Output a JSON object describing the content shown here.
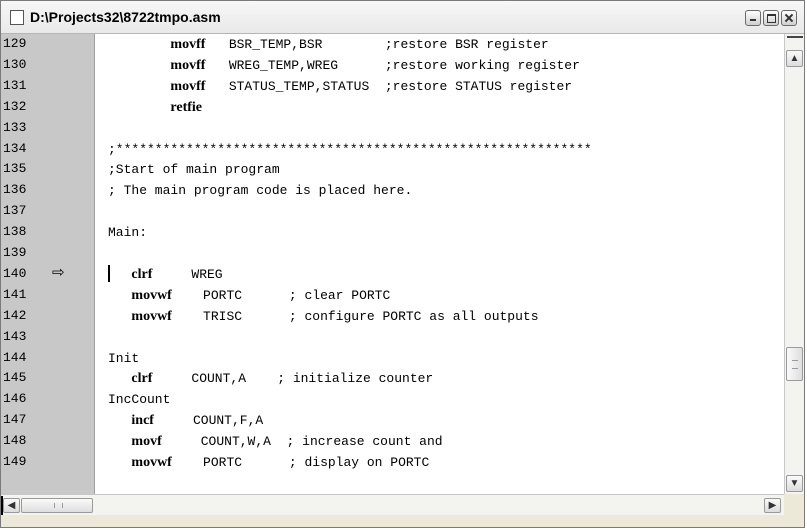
{
  "window": {
    "title": "D:\\Projects32\\8722tmpo.asm"
  },
  "titlebar_buttons": {
    "minimize": "minimize",
    "maximize": "maximize",
    "close": "close"
  },
  "icons": {
    "document": "document-icon",
    "arrow": "current-line-arrow-icon"
  },
  "lines": [
    {
      "num": "129",
      "mnemonic": "movff",
      "rest": "   BSR_TEMP,BSR        ;restore BSR register",
      "indent": "        "
    },
    {
      "num": "130",
      "mnemonic": "movff",
      "rest": "   WREG_TEMP,WREG      ;restore working register",
      "indent": "        "
    },
    {
      "num": "131",
      "mnemonic": "movff",
      "rest": "   STATUS_TEMP,STATUS  ;restore STATUS register",
      "indent": "        "
    },
    {
      "num": "132",
      "mnemonic": "retfie",
      "rest": "",
      "indent": "        "
    },
    {
      "num": "133",
      "mnemonic": "",
      "rest": "",
      "indent": ""
    },
    {
      "num": "134",
      "mnemonic": "",
      "rest": ";*************************************************************",
      "indent": ""
    },
    {
      "num": "135",
      "mnemonic": "",
      "rest": ";Start of main program",
      "indent": ""
    },
    {
      "num": "136",
      "mnemonic": "",
      "rest": "; The main program code is placed here.",
      "indent": ""
    },
    {
      "num": "137",
      "mnemonic": "",
      "rest": "",
      "indent": ""
    },
    {
      "num": "138",
      "mnemonic": "",
      "rest": "Main:",
      "indent": ""
    },
    {
      "num": "139",
      "mnemonic": "",
      "rest": "",
      "indent": ""
    },
    {
      "num": "140",
      "mnemonic": "clrf",
      "rest": "     WREG",
      "indent": "   "
    },
    {
      "num": "141",
      "mnemonic": "movwf",
      "rest": "    PORTC      ; clear PORTC",
      "indent": "   "
    },
    {
      "num": "142",
      "mnemonic": "movwf",
      "rest": "    TRISC      ; configure PORTC as all outputs",
      "indent": "   "
    },
    {
      "num": "143",
      "mnemonic": "",
      "rest": "",
      "indent": ""
    },
    {
      "num": "144",
      "mnemonic": "",
      "rest": "Init",
      "indent": ""
    },
    {
      "num": "145",
      "mnemonic": "clrf",
      "rest": "     COUNT,A    ; initialize counter",
      "indent": "   "
    },
    {
      "num": "146",
      "mnemonic": "",
      "rest": "IncCount",
      "indent": ""
    },
    {
      "num": "147",
      "mnemonic": "incf",
      "rest": "     COUNT,F,A",
      "indent": "   "
    },
    {
      "num": "148",
      "mnemonic": "movf",
      "rest": "     COUNT,W,A  ; increase count and",
      "indent": "   "
    },
    {
      "num": "149",
      "mnemonic": "movwf",
      "rest": "    PORTC      ; display on PORTC",
      "indent": "   "
    }
  ],
  "current_line": "140",
  "scrollbars": {
    "up": "scroll-up",
    "down": "scroll-down",
    "left": "scroll-left",
    "right": "scroll-right"
  }
}
